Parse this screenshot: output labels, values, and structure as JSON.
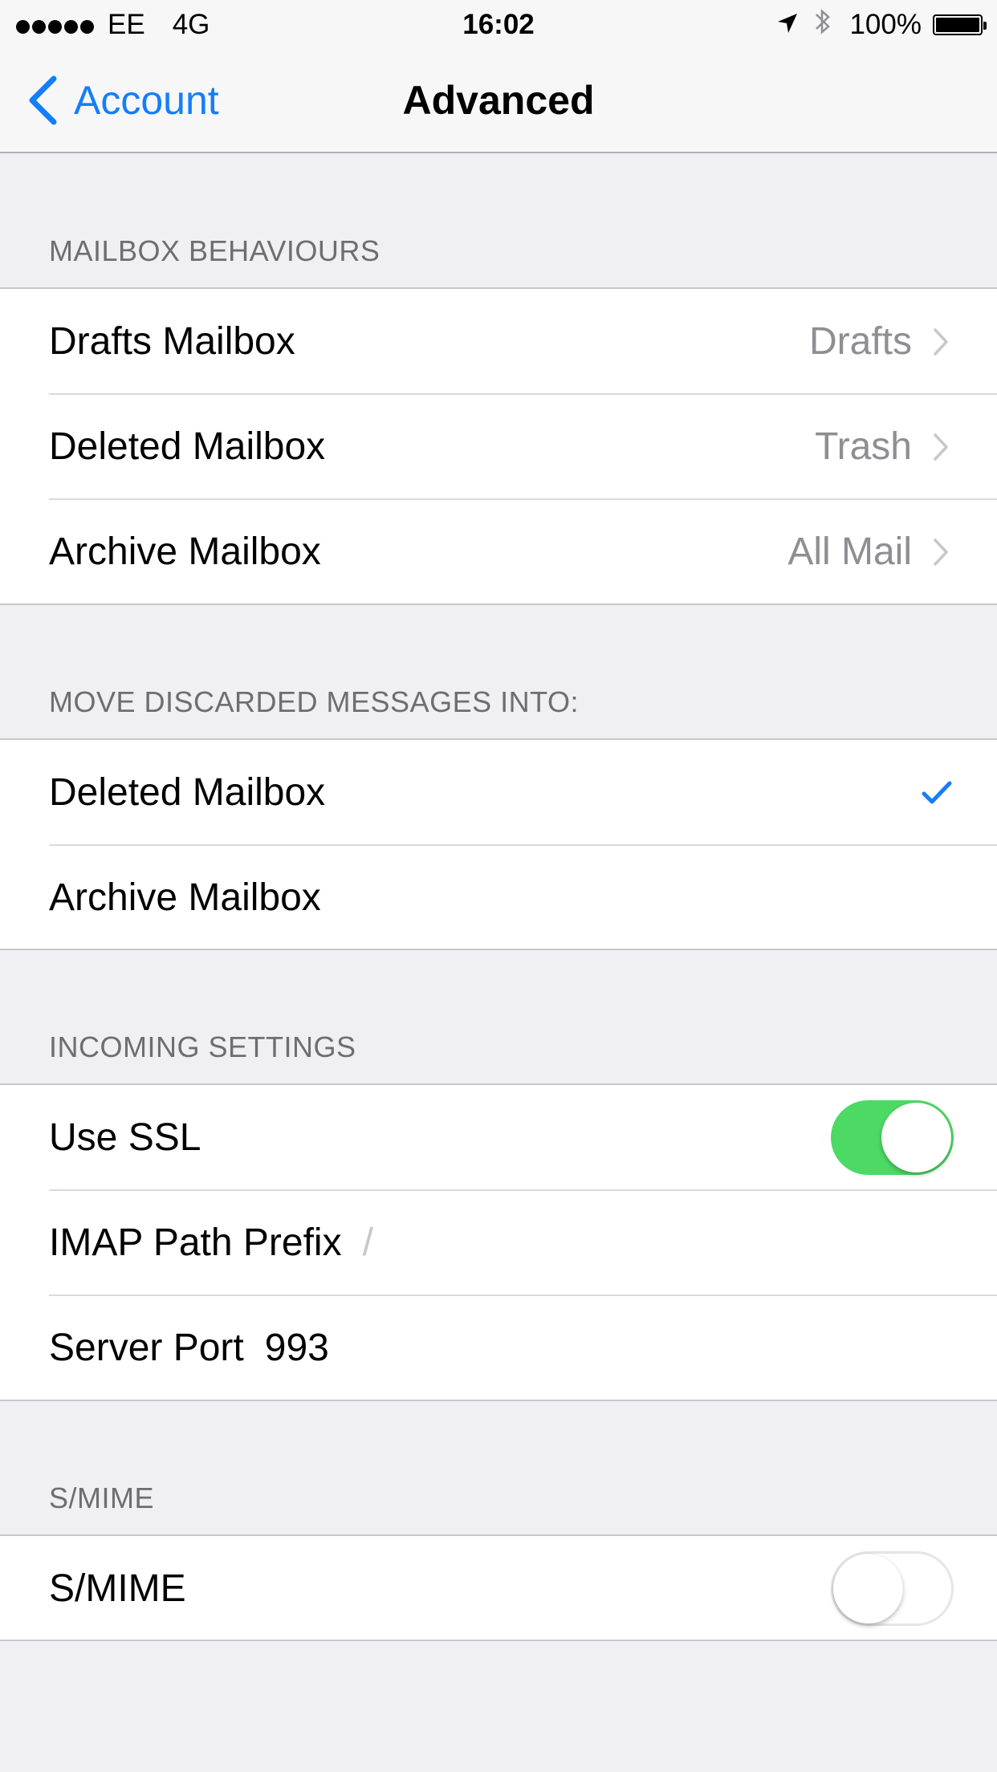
{
  "status_bar": {
    "carrier": "EE",
    "network": "4G",
    "time": "16:02",
    "battery": "100%",
    "signal_bars": 5
  },
  "nav": {
    "back_label": "Account",
    "title": "Advanced"
  },
  "mailbox_behaviours": {
    "header": "MAILBOX BEHAVIOURS",
    "rows": [
      {
        "label": "Drafts Mailbox",
        "value": "Drafts"
      },
      {
        "label": "Deleted Mailbox",
        "value": "Trash"
      },
      {
        "label": "Archive Mailbox",
        "value": "All Mail"
      }
    ]
  },
  "move_discarded": {
    "header": "MOVE DISCARDED MESSAGES INTO:",
    "rows": [
      {
        "label": "Deleted Mailbox",
        "selected": true
      },
      {
        "label": "Archive Mailbox",
        "selected": false
      }
    ]
  },
  "incoming_settings": {
    "header": "INCOMING SETTINGS",
    "use_ssl_label": "Use SSL",
    "use_ssl_on": true,
    "imap_prefix_label": "IMAP Path Prefix",
    "imap_prefix_value": "/",
    "server_port_label": "Server Port",
    "server_port_value": "993"
  },
  "smime": {
    "header": "S/MIME",
    "label": "S/MIME",
    "on": false
  },
  "colors": {
    "accent": "#147efb",
    "toggle_on": "#4cd964",
    "background": "#efeff4"
  }
}
